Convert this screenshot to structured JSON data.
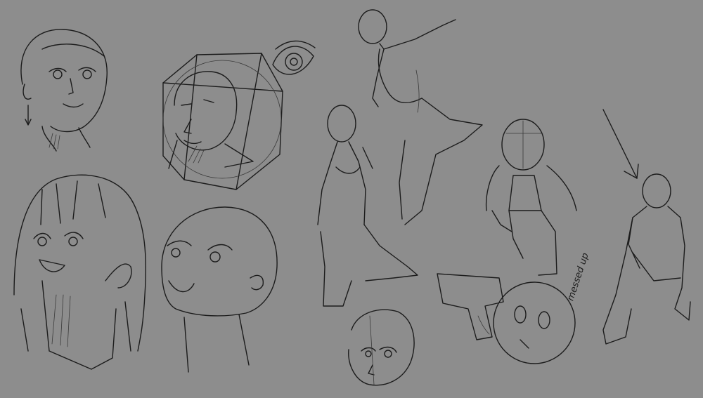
{
  "canvas": {
    "background": "#8d8d8d",
    "ink": "#1c1c1c",
    "ink_light": "#3a3a3a"
  },
  "sketches": [
    {
      "name": "bald-head-with-earring"
    },
    {
      "name": "head-in-construction-box"
    },
    {
      "name": "eye-study"
    },
    {
      "name": "girl-with-bangs"
    },
    {
      "name": "upturned-bald-head"
    },
    {
      "name": "mannequin-leaping"
    },
    {
      "name": "woman-kneeling"
    },
    {
      "name": "head-three-quarter"
    },
    {
      "name": "crouching-figure-hooded"
    },
    {
      "name": "gun-and-round-face"
    },
    {
      "name": "seated-figure-foreshortened"
    }
  ],
  "annotations": {
    "note": "messed up",
    "arrow": "arrow-down-left-icon"
  }
}
